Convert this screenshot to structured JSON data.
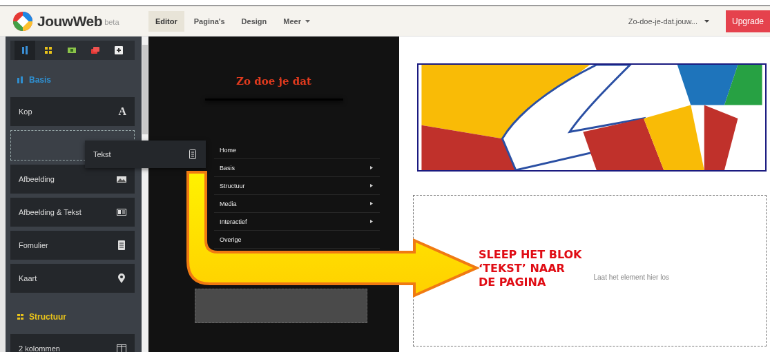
{
  "topbar": {
    "logo": "JouwWeb",
    "badge": "beta",
    "nav": [
      {
        "label": "Editor",
        "selected": true,
        "kind": "link"
      },
      {
        "label": "Pagina's",
        "selected": false,
        "kind": "link"
      },
      {
        "label": "Design",
        "selected": false,
        "kind": "link"
      },
      {
        "label": "Meer",
        "selected": false,
        "kind": "dropdown"
      }
    ],
    "site_selector": "Zo-doe-je-dat.jouw...",
    "upgrade": "Upgrade"
  },
  "sidebar": {
    "tabs": [
      {
        "selected": true
      },
      {
        "selected": false
      },
      {
        "selected": false
      },
      {
        "selected": false
      },
      {
        "selected": false
      }
    ],
    "sections": [
      {
        "title": "Basis",
        "color": "#2f8fd0",
        "kind": "basis",
        "items": [
          {
            "kind": "heading",
            "label": "Kop",
            "icon_text": "A"
          },
          {
            "kind": "placeholder"
          },
          {
            "kind": "image",
            "label": "Afbeelding"
          },
          {
            "kind": "image-text",
            "label": "Afbeelding & Tekst"
          },
          {
            "kind": "form",
            "label": "Fomulier"
          },
          {
            "kind": "map",
            "label": "Kaart"
          }
        ]
      },
      {
        "title": "Structuur",
        "color": "#e8c21a",
        "kind": "structure",
        "items": [
          {
            "kind": "columns",
            "label": "2 kolommen"
          }
        ]
      }
    ],
    "dragged": {
      "label": "Tekst"
    }
  },
  "preview": {
    "site_title": "Zo doe je dat",
    "menu": [
      {
        "label": "Home",
        "has_submenu": false
      },
      {
        "label": "Basis",
        "has_submenu": true
      },
      {
        "label": "Structuur",
        "has_submenu": true
      },
      {
        "label": "Media",
        "has_submenu": true
      },
      {
        "label": "Interactief",
        "has_submenu": true
      },
      {
        "label": "Overige",
        "has_submenu": false
      }
    ]
  },
  "page": {
    "drop_hint": "Laat het element hier los"
  },
  "annotation": {
    "text": "SLEEP HET BLOK\n‘TEKST’ NAAR\nDE PAGINA"
  }
}
